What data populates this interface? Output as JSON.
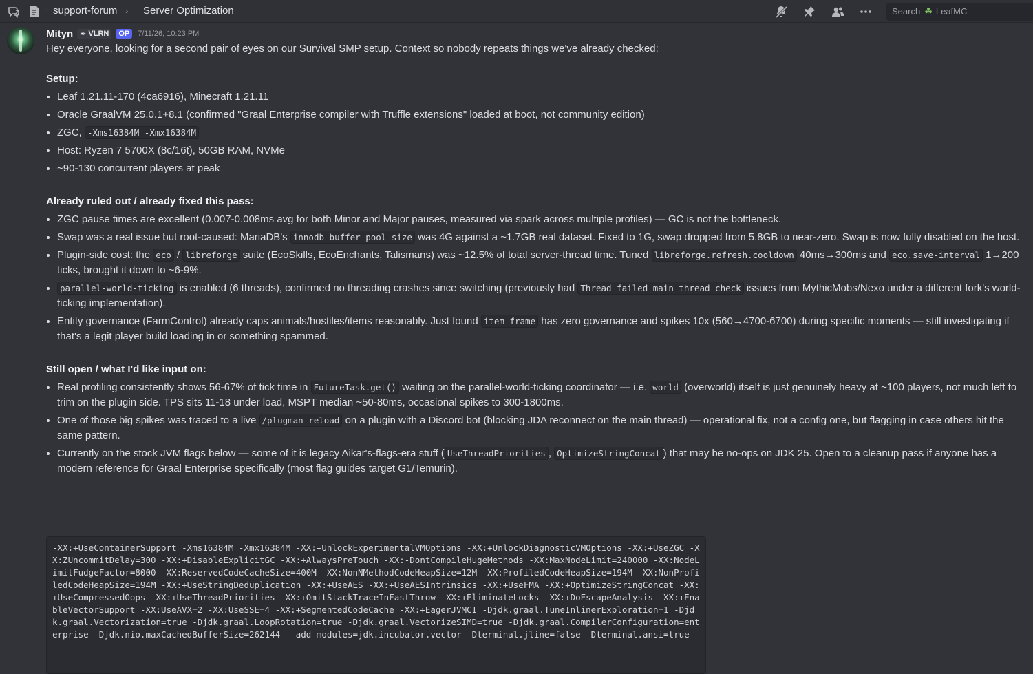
{
  "topbar": {
    "channel": "support-forum",
    "thread": "Server Optimization",
    "search_placeholder": "Search",
    "server": "LeafMC"
  },
  "message": {
    "author": "Mityn",
    "role_tag": "VLRN",
    "op_badge": "OP",
    "timestamp": "7/11/26, 10:23 PM",
    "intro": "Hey everyone, looking for a second pair of eyes on our Survival SMP setup. Context so nobody repeats things we've already checked:",
    "setup": {
      "heading": "Setup:",
      "items": {
        "1": "Leaf 1.21.11-170 (4ca6916), Minecraft 1.21.11",
        "2": "Oracle GraalVM 25.0.1+8.1 (confirmed \"Graal Enterprise compiler with Truffle extensions\" loaded at boot, not community edition)",
        "3a": "ZGC,",
        "3b": "-Xms16384M -Xmx16384M",
        "4": "Host: Ryzen 7 5700X (8c/16t), 50GB RAM, NVMe",
        "5": "~90-130 concurrent players at peak"
      }
    },
    "ruled": {
      "heading": "Already ruled out / already fixed this pass:",
      "i1": "ZGC pause times are excellent (0.007-0.008ms avg for both Minor and Major pauses, measured via spark across multiple profiles) — GC is not the bottleneck.",
      "i2a": "Swap was a real issue but root-caused: MariaDB's",
      "i2b": "innodb_buffer_pool_size",
      "i2c": "was 4G against a ~1.7GB real dataset. Fixed to 1G, swap dropped from 5.8GB to near-zero. Swap is now fully disabled on the host.",
      "i3a": "Plugin-side cost: the",
      "i3b": "eco",
      "i3c": "/",
      "i3d": "libreforge",
      "i3e": "suite (EcoSkills, EcoEnchants, Talismans) was ~12.5% of total server-thread time. Tuned",
      "i3f": "libreforge.refresh.cooldown",
      "i3g": "40ms→300ms and",
      "i3h": "eco.save-interval",
      "i3i": "1→200 ticks, brought it down to ~6-9%.",
      "i4a": "parallel-world-ticking",
      "i4b": "is enabled (6 threads), confirmed no threading crashes since switching (previously had",
      "i4c": "Thread failed main thread check",
      "i4d": "issues from MythicMobs/Nexo under a different fork's world-ticking implementation).",
      "i5a": "Entity governance (FarmControl) already caps animals/hostiles/items reasonably. Just found",
      "i5b": "item_frame",
      "i5c": "has zero governance and spikes 10x (560→4700-6700) during specific moments — still investigating if that's a legit player build loading in or something spammed."
    },
    "open": {
      "heading": "Still open / what I'd like input on:",
      "i1a": "Real profiling consistently shows 56-67% of tick time in",
      "i1b": "FutureTask.get()",
      "i1c": "waiting on the parallel-world-ticking coordinator — i.e.",
      "i1d": "world",
      "i1e": "(overworld) itself is just genuinely heavy at ~100 players, not much left to trim on the plugin side. TPS sits 11-18 under load, MSPT median ~50-80ms, occasional spikes to 300-1800ms.",
      "i2a": "One of those big spikes was traced to a live",
      "i2b": "/plugman reload",
      "i2c": "on a plugin with a Discord bot (blocking JDA reconnect on the main thread) — operational fix, not a config one, but flagging in case others hit the same pattern.",
      "i3a": "Currently on the stock JVM flags below — some of it is legacy Aikar's-flags-era stuff (",
      "i3b": "UseThreadPriorities",
      "i3c": ",",
      "i3d": "OptimizeStringConcat",
      "i3e": ") that may be no-ops on JDK 25. Open to a cleanup pass if anyone has a modern reference for Graal Enterprise specifically (most flag guides target G1/Temurin)."
    },
    "codeblock": "-XX:+UseContainerSupport -Xms16384M -Xmx16384M -XX:+UnlockExperimentalVMOptions -XX:+UnlockDiagnosticVMOptions -XX:+UseZGC -XX:ZUncommitDelay=300 -XX:+DisableExplicitGC -XX:+AlwaysPreTouch -XX:-DontCompileHugeMethods -XX:MaxNodeLimit=240000 -XX:NodeLimitFudgeFactor=8000 -XX:ReservedCodeCacheSize=400M -XX:NonNMethodCodeHeapSize=12M -XX:ProfiledCodeHeapSize=194M -XX:NonProfiledCodeHeapSize=194M -XX:+UseStringDeduplication -XX:+UseAES -XX:+UseAESIntrinsics -XX:+UseFMA -XX:+OptimizeStringConcat -XX:+UseCompressedOops -XX:+UseThreadPriorities -XX:+OmitStackTraceInFastThrow -XX:+EliminateLocks -XX:+DoEscapeAnalysis -XX:+EnableVectorSupport -XX:UseAVX=2 -XX:UseSSE=4 -XX:+SegmentedCodeCache -XX:+EagerJVMCI -Djdk.graal.TuneInlinerExploration=1 -Djdk.graal.Vectorization=true -Djdk.graal.LoopRotation=true -Djdk.graal.VectorizeSIMD=true -Djdk.graal.CompilerConfiguration=enterprise -Djdk.nio.maxCachedBufferSize=262144 --add-modules=jdk.incubator.vector -Dterminal.jline=false -Dterminal.ansi=true"
  }
}
